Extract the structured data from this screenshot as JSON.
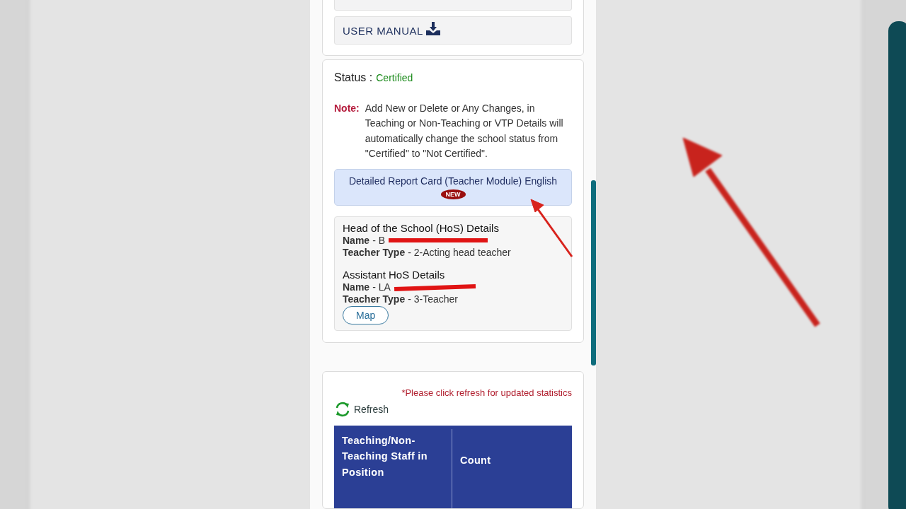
{
  "user_manual": "USER MANUAL",
  "status": {
    "label": "Status :",
    "value": "Certified"
  },
  "note": {
    "label": "Note:",
    "text": "Add New or Delete or Any Changes, in Teaching or Non-Teaching or VTP Details will automatically change the school status from \"Certified\" to \"Not Certified\"."
  },
  "report_card": {
    "label": "Detailed Report Card (Teacher Module) English",
    "badge": "NEW"
  },
  "hos": [
    {
      "title": "Head of the School (HoS) Details",
      "name_label": "Name",
      "name": "- B",
      "type_label": "Teacher Type",
      "type": "- 2-Acting head teacher"
    },
    {
      "title": "Assistant HoS Details",
      "name_label": "Name",
      "name": "- LA",
      "type_label": "Teacher Type",
      "type": "- 3-Teacher"
    }
  ],
  "map_button": "Map",
  "stats": {
    "notice": "*Please click refresh for updated statistics",
    "refresh": "Refresh",
    "columns": [
      "Teaching/Non-Teaching Staff in Position",
      "Count"
    ]
  }
}
